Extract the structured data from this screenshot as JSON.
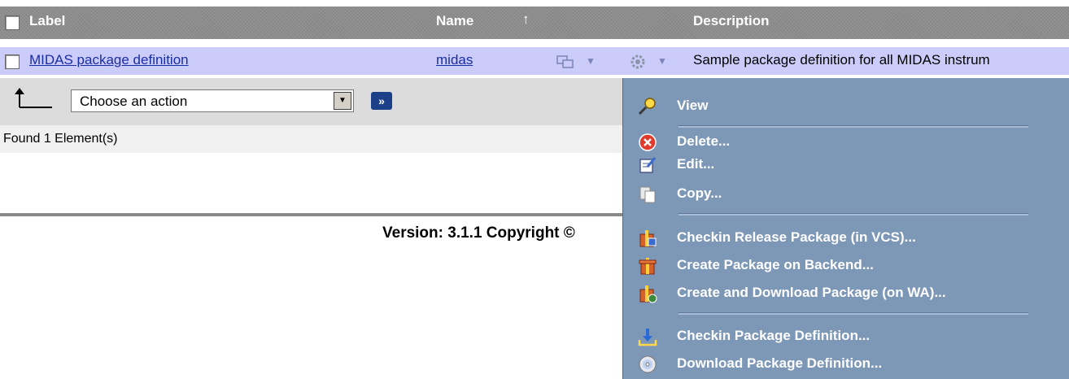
{
  "header": {
    "col_label": "Label",
    "col_name": "Name",
    "col_description": "Description",
    "sort_arrow": "↑"
  },
  "row": {
    "label": "MIDAS package definition",
    "name": "midas",
    "description": "Sample package definition for all MIDAS instrum"
  },
  "action_bar": {
    "select_value": "Choose an action",
    "go_label": "»"
  },
  "status": {
    "found": "Found 1 Element(s)"
  },
  "footer": {
    "version": "Version: 3.1.1  Copyright ©"
  },
  "context_menu": {
    "items": [
      {
        "label": "View",
        "icon": "magnifier-icon"
      },
      {
        "label": "Delete...",
        "icon": "delete-icon"
      },
      {
        "label": "Edit...",
        "icon": "edit-icon"
      },
      {
        "label": "Copy...",
        "icon": "copy-icon"
      },
      {
        "label": "Checkin Release Package (in VCS)...",
        "icon": "checkin-release-icon"
      },
      {
        "label": "Create Package on Backend...",
        "icon": "create-package-icon"
      },
      {
        "label": "Create and Download Package (on WA)...",
        "icon": "create-download-package-icon"
      },
      {
        "label": "Checkin Package Definition...",
        "icon": "checkin-definition-icon"
      },
      {
        "label": "Download Package Definition...",
        "icon": "download-definition-icon"
      }
    ]
  },
  "colors": {
    "header_bg": "#8d8d8d",
    "row_bg": "#ccccfa",
    "link": "#1a2ea3",
    "menu_bg": "#7d97b6",
    "action_bar_bg": "#dcdcdc"
  }
}
